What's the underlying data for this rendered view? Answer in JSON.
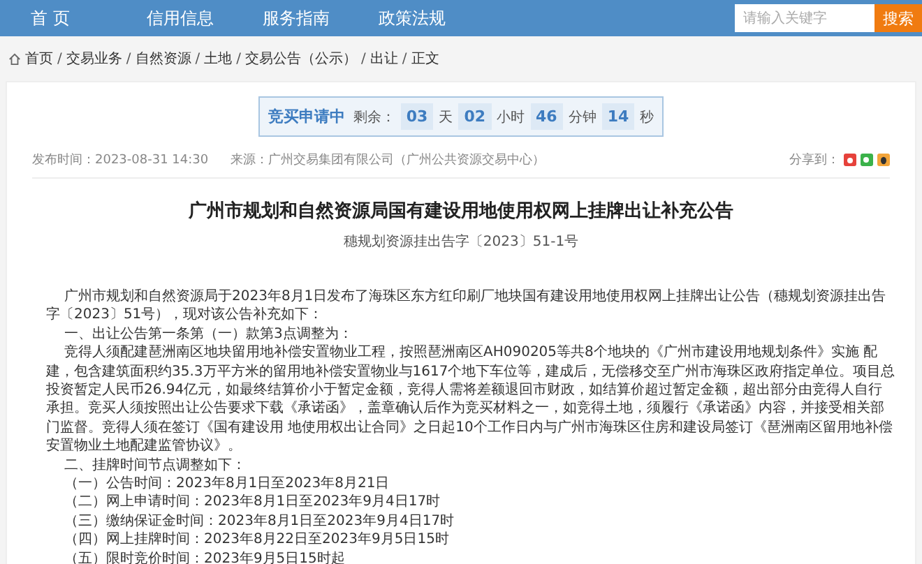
{
  "nav": {
    "items": [
      "首 页",
      "信用信息",
      "服务指南",
      "政策法规"
    ],
    "search": {
      "placeholder": "请输入关键字",
      "button": "搜索"
    }
  },
  "breadcrumb": {
    "separator": "/",
    "items": [
      "首页",
      "交易业务",
      "自然资源",
      "土地",
      "交易公告（公示）",
      "出让",
      "正文"
    ]
  },
  "countdown": {
    "status": "竞买申请中",
    "label": "剩余：",
    "parts": [
      {
        "value": "03",
        "unit": "天"
      },
      {
        "value": "02",
        "unit": "小时"
      },
      {
        "value": "46",
        "unit": "分钟"
      },
      {
        "value": "14",
        "unit": "秒"
      }
    ]
  },
  "meta": {
    "published": "发布时间：2023-08-31 14:30",
    "source": "来源：广州交易集团有限公司（广州公共资源交易中心）",
    "share_label": "分享到："
  },
  "article": {
    "title": "广州市规划和自然资源局国有建设用地使用权网上挂牌出让补充公告",
    "doc_number": "穗规划资源挂出告字〔2023〕51-1号",
    "paragraphs": [
      "广州市规划和自然资源局于2023年8月1日发布了海珠区东方红印刷厂地块国有建设用地使用权网上挂牌出让公告（穗规划资源挂出告字〔2023〕51号），现对该公告补充如下：",
      "一、出让公告第一条第（一）款第3点调整为：",
      "竞得人须配建琶洲南区地块留用地补偿安置物业工程，按照琶洲南区AH090205等共8个地块的《广州市建设用地规划条件》实施 配建，包含建筑面积约35.3万平方米的留用地补偿安置物业与1617个地下车位等，建成后，无偿移交至广州市海珠区政府指定单位。项目总投资暂定人民币26.94亿元，如最终结算价小于暂定金额，竞得人需将差额退回市财政，如结算价超过暂定金额，超出部分由竞得人自行承担。竞买人须按照出让公告要求下载《承诺函》，盖章确认后作为竞买材料之一，如竞得土地，须履行《承诺函》内容，并接受相关部门监督。竞得人须在签订《国有建设用 地使用权出让合同》之日起10个工作日内与广州市海珠区住房和建设局签订《琶洲南区留用地补偿安置物业土地配建监管协议》。",
      "二、挂牌时间节点调整如下：",
      "（一）公告时间：2023年8月1日至2023年8月21日",
      "（二）网上申请时间：2023年8月1日至2023年9月4日17时",
      "（三）缴纳保证金时间：2023年8月1日至2023年9月4日17时",
      "（四）网上挂牌时间：2023年8月22日至2023年9月5日15时",
      "（五）限时竞价时间：2023年9月5日15时起"
    ]
  }
}
